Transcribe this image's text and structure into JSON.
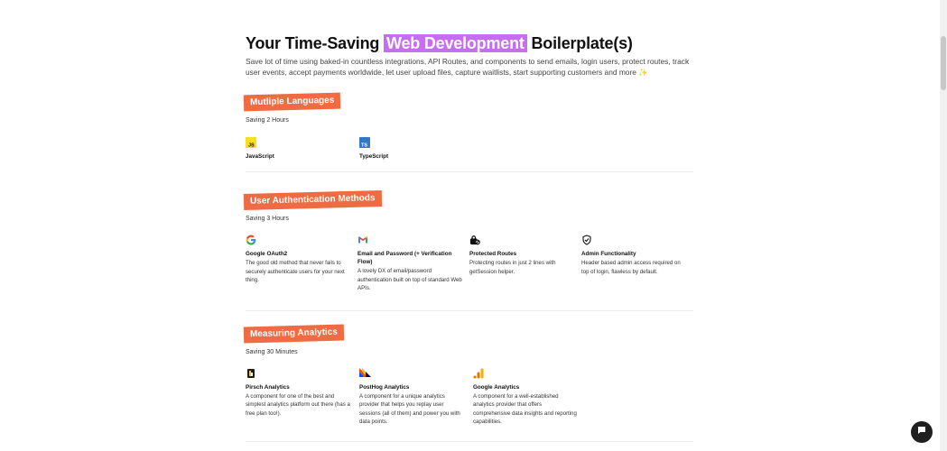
{
  "hero": {
    "title_before": "Your Time-Saving",
    "title_highlight": "Web Development",
    "title_after": "Boilerplate(s)",
    "subtitle": "Save lot of time using baked-in countless integrations, API Routes, and components to send emails, login users, protect routes, track user events, accept payments worldwide, let user upload files, capture waitlists, start supporting customers and more ✨"
  },
  "sections": [
    {
      "label": "Mutliple Languages",
      "saving": "Saving 2 Hours",
      "items": [
        {
          "icon": "javascript-icon",
          "title": "JavaScript",
          "desc": ""
        },
        {
          "icon": "typescript-icon",
          "title": "TypeScript",
          "desc": ""
        }
      ]
    },
    {
      "label": "User Authentication Methods",
      "saving": "Saving 3 Hours",
      "items": [
        {
          "icon": "google-icon",
          "title": "Google OAuth2",
          "desc": "The good old method that never fails to securely authenticate users for your next thing."
        },
        {
          "icon": "gmail-icon",
          "title": "Email and Password (+ Verification Flow)",
          "desc": "A lovely DX of email/password authentication built on top of standard Web APIs."
        },
        {
          "icon": "lock-icon",
          "title": "Protected Routes",
          "desc": "Protecting routes in just 2 lines with getSession helper."
        },
        {
          "icon": "shield-check-icon",
          "title": "Admin Functionality",
          "desc": "Header based admin access required on top of login, flawless by default."
        }
      ]
    },
    {
      "label": "Measuring Analytics",
      "saving": "Saving 30 Minutes",
      "items": [
        {
          "icon": "pirsch-icon",
          "title": "Pirsch Analytics",
          "desc": "A component for one of the best and simplest analytics platform out there (has a free plan too!)."
        },
        {
          "icon": "posthog-icon",
          "title": "PostHog Analytics",
          "desc": "A component for a unique analytics provider that helps you replay user sessions (all of them) and power you with data points."
        },
        {
          "icon": "google-analytics-icon",
          "title": "Google Analytics",
          "desc": "A component for a well-established analytics provider that offers comprehensive data insights and reporting capabilities."
        }
      ]
    }
  ],
  "chat": {
    "icon": "chat-icon"
  },
  "colors": {
    "highlight": "#c56ef0",
    "pill": "#f06a43"
  }
}
